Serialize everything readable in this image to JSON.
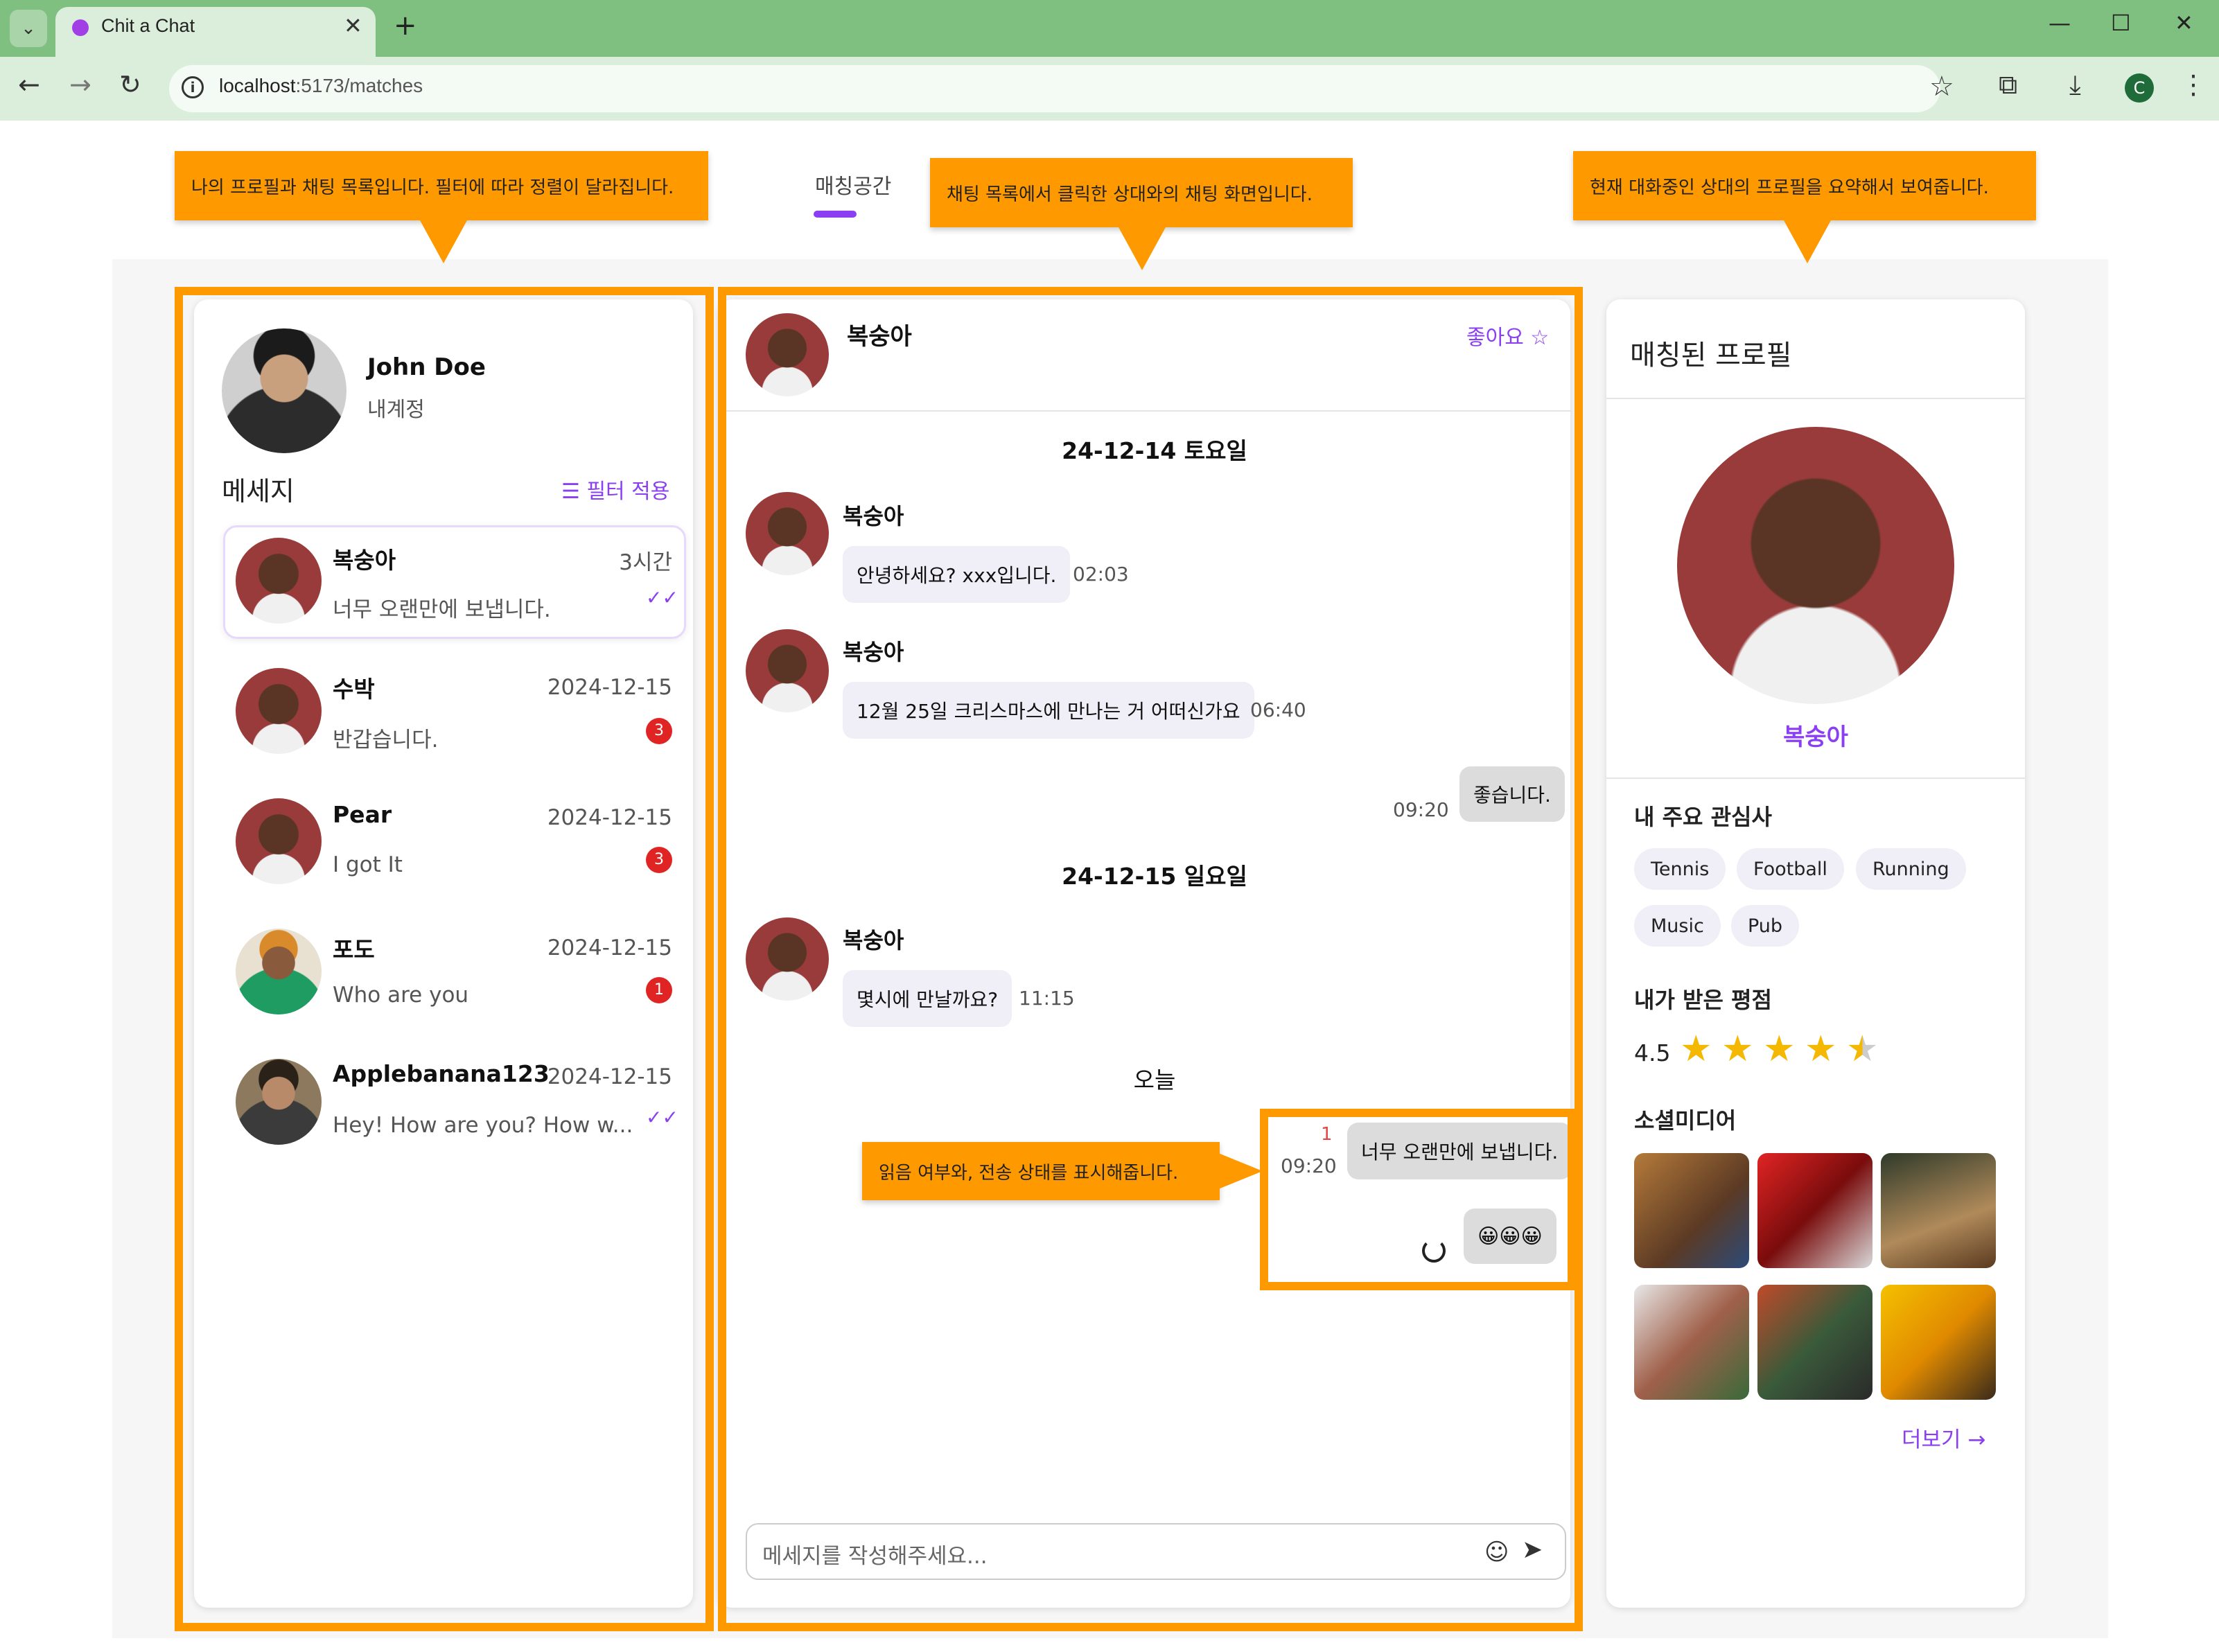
{
  "browser": {
    "tab_title": "Chit a Chat",
    "url_host": "localhost",
    "url_path": ":5173/matches",
    "tab_close": "✕",
    "new_tab": "+",
    "profile_initial": "C"
  },
  "nav": {
    "tab": "매칭공간"
  },
  "callouts": {
    "left": "나의 프로필과 채팅 목록입니다. 필터에 따라 정렬이 달라집니다.",
    "chat": "채팅 목록에서 클릭한 상대와의 채팅 화면입니다.",
    "right": "현재 대화중인 상대의 프로필을 요약해서 보여줍니다.",
    "status": "읽음 여부와, 전송 상태를 표시해줍니다."
  },
  "me": {
    "name": "John Doe",
    "sub": "내계정"
  },
  "messages_panel": {
    "title": "메세지",
    "filter": "필터 적용",
    "conversations": [
      {
        "name": "복숭아",
        "time": "3시간",
        "preview": "너무 오랜만에 보냅니다.",
        "status": "read",
        "avatar": "woman"
      },
      {
        "name": "수박",
        "time": "2024-12-15",
        "preview": "반갑습니다.",
        "unread": "3",
        "avatar": "woman"
      },
      {
        "name": "Pear",
        "time": "2024-12-15",
        "preview": "I got It",
        "unread": "3",
        "avatar": "woman"
      },
      {
        "name": "포도",
        "time": "2024-12-15",
        "preview": "Who are you",
        "unread": "1",
        "avatar": "boy"
      },
      {
        "name": "Applebanana123",
        "time": "2024-12-15",
        "preview": "Hey! How are you? How w...",
        "status": "read",
        "avatar": "guy"
      }
    ],
    "check_mark": "✓✓"
  },
  "chat": {
    "partner": "복숭아",
    "like": "좋아요 ☆",
    "dates": [
      "24-12-14 토요일",
      "24-12-15 일요일",
      "오늘"
    ],
    "messages": [
      {
        "from": "복숭아",
        "text": "안녕하세요? xxx입니다.",
        "time": "02:03"
      },
      {
        "from": "복숭아",
        "text": "12월 25일 크리스마스에 만나는 거 어떠신가요",
        "time": "06:40"
      },
      {
        "from": "me",
        "text": "좋습니다.",
        "time": "09:20"
      },
      {
        "from": "복숭아",
        "text": "몇시에 만날까요?",
        "time": "11:15"
      },
      {
        "from": "me",
        "text": "너무 오랜만에 보냅니다.",
        "time": "09:20",
        "unread_count": "1"
      },
      {
        "from": "me",
        "text": "😀😀😀",
        "status": "sending"
      }
    ],
    "input_placeholder": "메세지를 작성해주세요..."
  },
  "profile": {
    "title": "매칭된 프로필",
    "name": "복숭아",
    "interests_title": "내 주요 관심사",
    "interests": [
      "Tennis",
      "Football",
      "Running",
      "Music",
      "Pub"
    ],
    "rating_title": "내가 받은 평점",
    "rating": "4.5",
    "rating_value": 4.5,
    "rating_max": 5,
    "sns_title": "소셜미디어",
    "more": "더보기 →"
  },
  "colors": {
    "accent": "#8b3ff2",
    "callout": "#ff9900",
    "badge": "#e02424",
    "star": "#f5b800"
  }
}
